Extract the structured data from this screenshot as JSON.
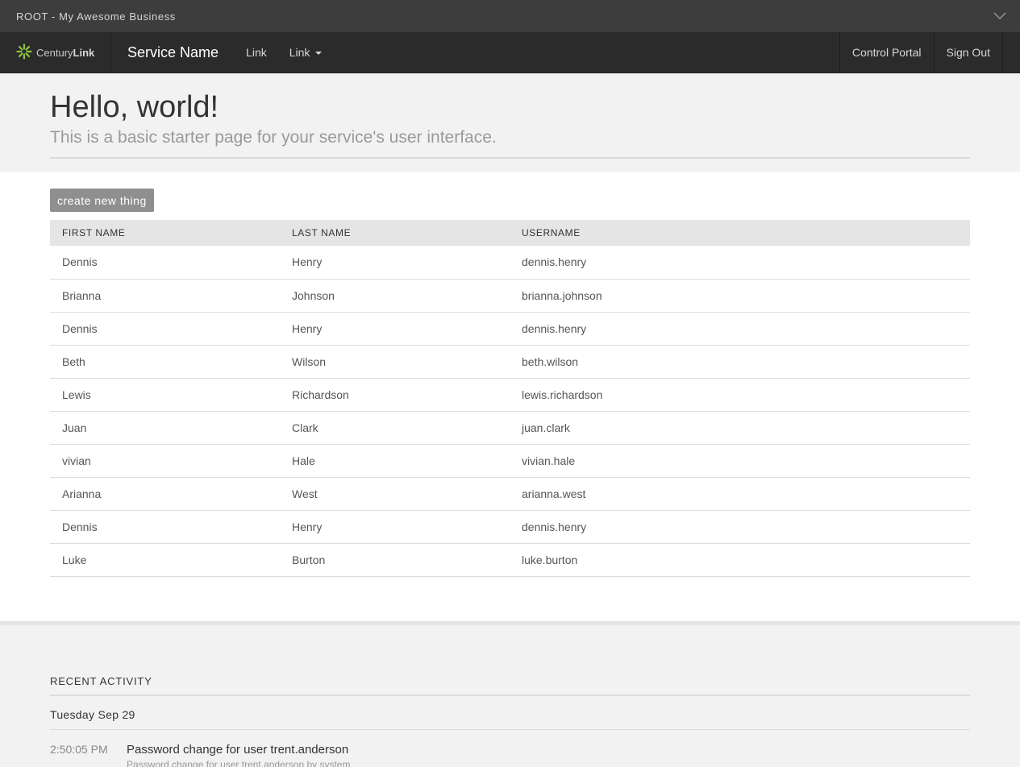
{
  "account_bar": {
    "title": "ROOT - My Awesome Business",
    "chevron_icon": "chevron-down-icon"
  },
  "navbar": {
    "brand_light": "Century",
    "brand_bold": "Link",
    "brand_icon": "centurylink-logo-icon",
    "service_name": "Service Name",
    "links": [
      "Link",
      "Link"
    ],
    "right_links": [
      "Control Portal",
      "Sign Out"
    ]
  },
  "hero": {
    "title": "Hello, world!",
    "subtitle": "This is a basic starter page for your service's user interface."
  },
  "main": {
    "create_button": "create new thing",
    "table": {
      "headers": [
        "FIRST NAME",
        "LAST NAME",
        "USERNAME"
      ],
      "rows": [
        [
          "Dennis",
          "Henry",
          "dennis.henry"
        ],
        [
          "Brianna",
          "Johnson",
          "brianna.johnson"
        ],
        [
          "Dennis",
          "Henry",
          "dennis.henry"
        ],
        [
          "Beth",
          "Wilson",
          "beth.wilson"
        ],
        [
          "Lewis",
          "Richardson",
          "lewis.richardson"
        ],
        [
          "Juan",
          "Clark",
          "juan.clark"
        ],
        [
          "vivian",
          "Hale",
          "vivian.hale"
        ],
        [
          "Arianna",
          "West",
          "arianna.west"
        ],
        [
          "Dennis",
          "Henry",
          "dennis.henry"
        ],
        [
          "Luke",
          "Burton",
          "luke.burton"
        ]
      ]
    }
  },
  "activity": {
    "heading": "RECENT ACTIVITY",
    "day": "Tuesday Sep 29",
    "events": [
      {
        "time": "2:50:05 PM",
        "title": "Password change for user trent.anderson",
        "detail": "Password change for user trent.anderson by system"
      }
    ]
  },
  "colors": {
    "account_bar_bg": "#3d3d3d",
    "navbar_bg": "#2b2b2b",
    "brand_green": "#8dc63f",
    "button_bg": "#8f8f8f",
    "hero_bg": "#f2f2f2"
  }
}
